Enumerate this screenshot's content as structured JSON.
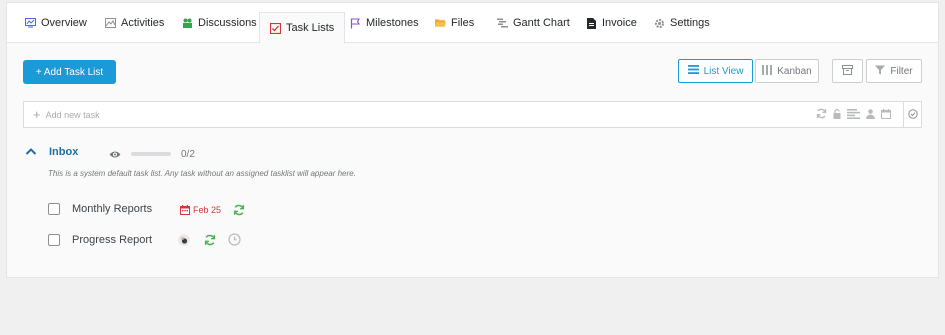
{
  "tabs": [
    {
      "label": "Overview",
      "icon": "monitor-icon"
    },
    {
      "label": "Activities",
      "icon": "image-icon"
    },
    {
      "label": "Discussions",
      "icon": "users-icon"
    },
    {
      "label": "Task Lists",
      "icon": "checkbox-icon",
      "active": true
    },
    {
      "label": "Milestones",
      "icon": "flag-icon"
    },
    {
      "label": "Files",
      "icon": "folder-icon"
    },
    {
      "label": "Gantt Chart",
      "icon": "gantt-icon"
    },
    {
      "label": "Invoice",
      "icon": "document-icon"
    },
    {
      "label": "Settings",
      "icon": "gear-icon"
    }
  ],
  "toolbar": {
    "add_task_list": "+ Add Task List",
    "list_view": "List View",
    "kanban": "Kanban",
    "filter": "Filter"
  },
  "new_task": {
    "placeholder": "Add new task"
  },
  "tasklist": {
    "title": "Inbox",
    "progress_text": "0/2",
    "progress": 0,
    "description": "This is a system default task list. Any task without an assigned tasklist will appear here.",
    "tasks": [
      {
        "name": "Monthly Reports",
        "due": "Feb 25"
      },
      {
        "name": "Progress Report"
      }
    ]
  },
  "colors": {
    "accent": "#1a9bd7",
    "due": "#d63638",
    "repeat": "#46b450",
    "title": "#1d6fa5"
  }
}
